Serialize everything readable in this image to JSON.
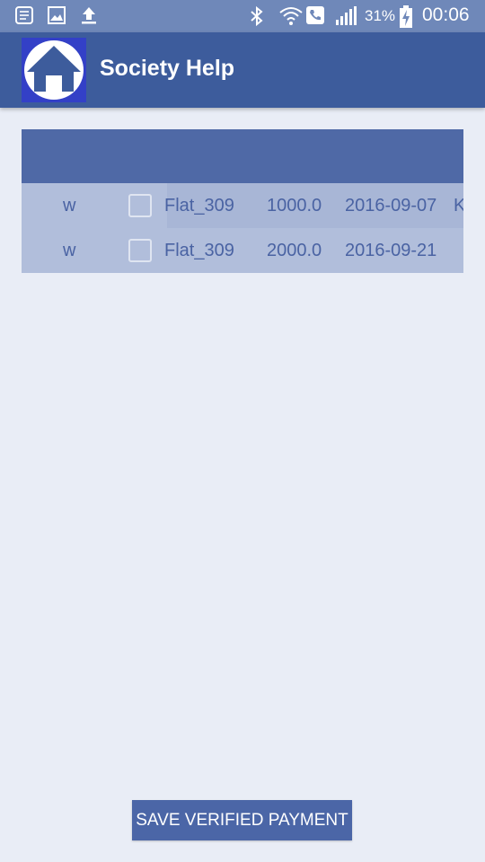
{
  "status_bar": {
    "battery_percent": "31%",
    "time": "00:06",
    "icons": [
      "notes-icon",
      "image-icon",
      "upload-icon",
      "bluetooth-icon",
      "wifi-icon",
      "call-icon",
      "signal-icon",
      "battery-charging-icon"
    ]
  },
  "app_bar": {
    "title": "Society Help",
    "logo_icon": "home-icon",
    "logo_color": "#3340c7",
    "bar_color": "#3d5c9c"
  },
  "table": {
    "rows": [
      {
        "name": "w",
        "checked": false,
        "flat": "Flat_309",
        "amount": "1000.0",
        "date": "2016-09-07",
        "extra": "K"
      },
      {
        "name": "w",
        "checked": false,
        "flat": "Flat_309",
        "amount": "2000.0",
        "date": "2016-09-21",
        "extra": ""
      }
    ]
  },
  "actions": {
    "save_label": "SAVE VERIFIED PAYMENT"
  }
}
